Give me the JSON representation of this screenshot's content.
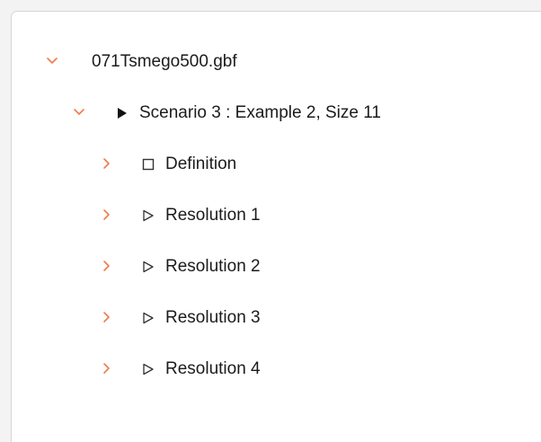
{
  "tree": {
    "root": {
      "label": "071Tsmego500.gbf",
      "expanded": true,
      "chevron_icon": "chevron-down-icon"
    },
    "scenario": {
      "label": "Scenario 3 : Example 2, Size 11",
      "expanded": true,
      "chevron_icon": "chevron-down-icon",
      "glyph_icon": "filled-play-triangle-icon"
    },
    "children": [
      {
        "label": "Definition",
        "glyph_icon": "square-outline-icon",
        "chevron_icon": "chevron-right-icon"
      },
      {
        "label": "Resolution 1",
        "glyph_icon": "outline-play-triangle-icon",
        "chevron_icon": "chevron-right-icon"
      },
      {
        "label": "Resolution 2",
        "glyph_icon": "outline-play-triangle-icon",
        "chevron_icon": "chevron-right-icon"
      },
      {
        "label": "Resolution 3",
        "glyph_icon": "outline-play-triangle-icon",
        "chevron_icon": "chevron-right-icon"
      },
      {
        "label": "Resolution 4",
        "glyph_icon": "outline-play-triangle-icon",
        "chevron_icon": "chevron-right-icon"
      }
    ]
  },
  "colors": {
    "chevron": "#f07b4a",
    "text": "#1b1b1b",
    "panel_background": "#ffffff",
    "window_background": "#f3f3f3",
    "border": "#d6d6d6"
  }
}
